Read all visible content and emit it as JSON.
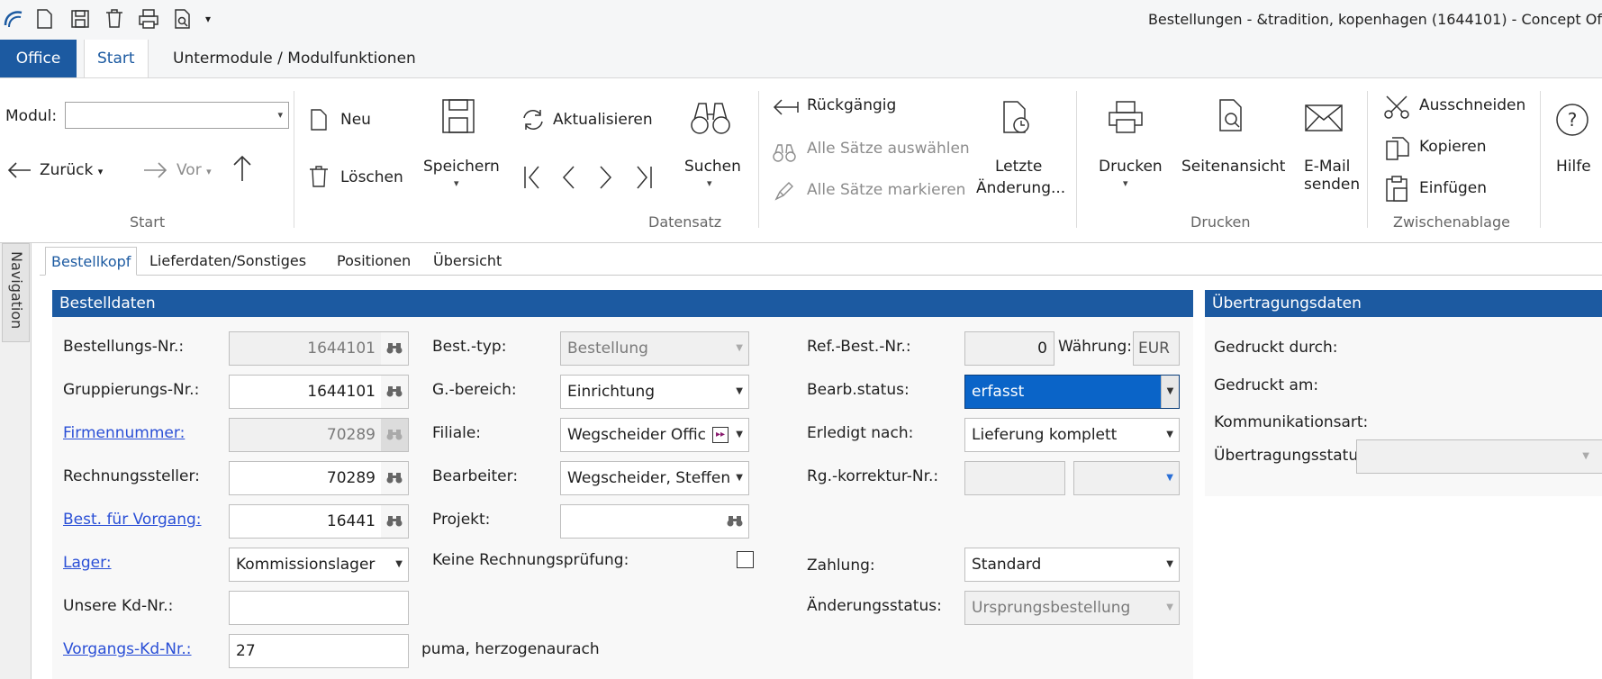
{
  "window": {
    "title": "Bestellungen - &tradition, kopenhagen (1644101) - Concept Of"
  },
  "ribbon_tabs": {
    "office": "Office",
    "start": "Start",
    "untermodule": "Untermodule / Modulfunktionen"
  },
  "ribbon": {
    "start_group": {
      "modul_label": "Modul:",
      "zurueck": "Zurück",
      "vor": "Vor",
      "group_label": "Start"
    },
    "datensatz": {
      "neu": "Neu",
      "loeschen": "Löschen",
      "speichern": "Speichern",
      "aktualisieren": "Aktualisieren",
      "suchen": "Suchen",
      "rueckgaengig": "Rückgängig",
      "alle_saetze_auswaehlen": "Alle Sätze auswählen",
      "alle_saetze_markieren": "Alle Sätze markieren",
      "letzte_line1": "Letzte",
      "letzte_line2": "Änderung...",
      "group_label": "Datensatz"
    },
    "drucken": {
      "drucken": "Drucken",
      "seitenansicht": "Seitenansicht",
      "email_line1": "E-Mail",
      "email_line2": "senden",
      "group_label": "Drucken"
    },
    "zwischenablage": {
      "ausschneiden": "Ausschneiden",
      "kopieren": "Kopieren",
      "einfuegen": "Einfügen",
      "group_label": "Zwischenablage"
    },
    "hilfe": "Hilfe"
  },
  "navigation": {
    "label": "Navigation"
  },
  "content_tabs": {
    "bestellkopf": "Bestellkopf",
    "lieferdaten": "Lieferdaten/Sonstiges",
    "positionen": "Positionen",
    "uebersicht": "Übersicht"
  },
  "bestelldaten": {
    "header": "Bestelldaten",
    "col1": {
      "bestellungs_nr_label": "Bestellungs-Nr.:",
      "bestellungs_nr": "1644101",
      "gruppierungs_nr_label": "Gruppierungs-Nr.:",
      "gruppierungs_nr": "1644101",
      "firmennummer_label": "Firmennummer:",
      "firmennummer": "70289",
      "rechnungssteller_label": "Rechnungssteller:",
      "rechnungssteller": "70289",
      "best_fuer_vorgang_label": "Best. für Vorgang:",
      "best_fuer_vorgang": "16441",
      "lager_label": "Lager:",
      "lager": "Kommissionslager",
      "unsere_kd_nr_label": "Unsere Kd-Nr.:",
      "unsere_kd_nr": "",
      "vorgangs_kd_nr_label": "Vorgangs-Kd-Nr.:",
      "vorgangs_kd_nr": "27",
      "vorgangs_kd_name": "puma, herzogenaurach"
    },
    "col2": {
      "best_typ_label": "Best.-typ:",
      "best_typ": "Bestellung",
      "g_bereich_label": "G.-bereich:",
      "g_bereich": "Einrichtung",
      "filiale_label": "Filiale:",
      "filiale": "Wegscheider Offic",
      "bearbeiter_label": "Bearbeiter:",
      "bearbeiter": "Wegscheider, Steffen",
      "projekt_label": "Projekt:",
      "projekt": "",
      "keine_rechnungspruefung_label": "Keine Rechnungsprüfung:"
    },
    "col3": {
      "ref_best_nr_label": "Ref.-Best.-Nr.:",
      "ref_best_nr": "0",
      "waehrung_label": "Währung:",
      "waehrung": "EUR",
      "bearb_status_label": "Bearb.status:",
      "bearb_status": "erfasst",
      "erledigt_nach_label": "Erledigt nach:",
      "erledigt_nach": "Lieferung komplett",
      "rg_korrektur_nr_label": "Rg.-korrektur-Nr.:",
      "zahlung_label": "Zahlung:",
      "zahlung": "Standard",
      "aenderungsstatus_label": "Änderungsstatus:",
      "aenderungsstatus": "Ursprungsbestellung"
    }
  },
  "uebertragungsdaten": {
    "header": "Übertragungsdaten",
    "gedruckt_durch_label": "Gedruckt durch:",
    "gedruckt_am_label": "Gedruckt am:",
    "kommunikationsart_label": "Kommunikationsart:",
    "uebertragungsstatus_label": "Übertragungsstatus:"
  },
  "colors": {
    "accent": "#1c5aa1",
    "link": "#2a4fd6",
    "selection": "#0a64c8"
  }
}
